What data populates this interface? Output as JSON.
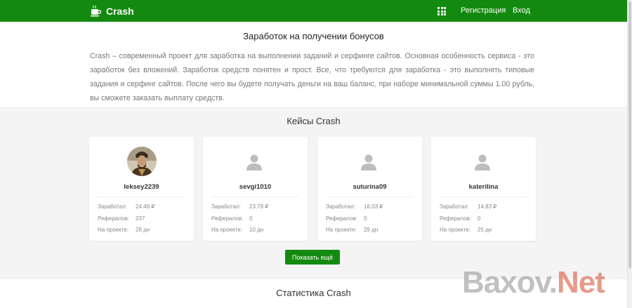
{
  "header": {
    "brand": "Crash",
    "nav": {
      "register": "Регистрация",
      "login": "Вход"
    },
    "bg_color": "#138a0f"
  },
  "intro": {
    "title": "Заработок на получении бонусов",
    "text": "Crash – современный проект для заработка на выполнении заданий и серфинге сайтов. Основная особенность сервиса - это заработок без вложений. Заработок средств понятен и прост. Все, что требуются для заработка - это выполнять типовые задания и серфинг сайтов. После чего вы будете получать деньги на ваш баланс, при наборе минимальной суммы 1.00 рубль, вы сможете заказать выплату средств."
  },
  "cases": {
    "title": "Кейсы Crash",
    "labels": {
      "earned": "Заработал:",
      "referrals": "Рефералов:",
      "on_project": "На проекте:"
    },
    "cards": [
      {
        "username": "leksey2239",
        "earned": "24.49 ₽",
        "referrals": "237",
        "on_project": "28 дн",
        "avatar": "photo"
      },
      {
        "username": "sevgi1010",
        "earned": "23.79 ₽",
        "referrals": "0",
        "on_project": "10 дн",
        "avatar": "user-icon"
      },
      {
        "username": "suturina09",
        "earned": "16.03 ₽",
        "referrals": "0",
        "on_project": "29 дн",
        "avatar": "user-icon"
      },
      {
        "username": "katerilina",
        "earned": "14.83 ₽",
        "referrals": "0",
        "on_project": "25 дн",
        "avatar": "user-icon"
      }
    ],
    "more_button": "Показать ещё"
  },
  "stats": {
    "title": "Статистика Crash"
  },
  "watermark": {
    "part1": "Baxov.",
    "part2": "Net"
  }
}
